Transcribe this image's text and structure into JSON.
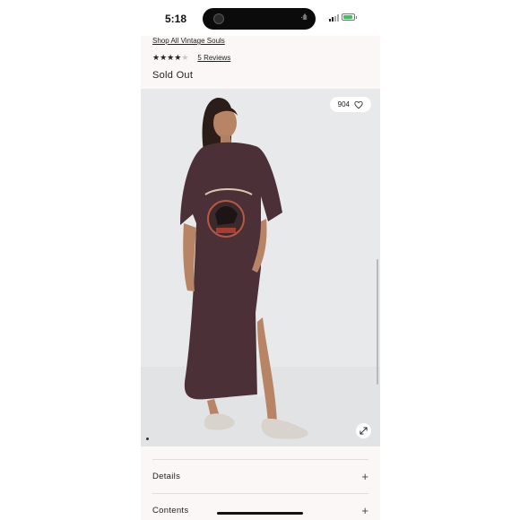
{
  "status_bar": {
    "time": "5:18"
  },
  "product": {
    "shop_link": "Shop All Vintage Souls",
    "rating_stars": 4,
    "rating_max": 5,
    "reviews_label": "5 Reviews",
    "availability": "Sold Out"
  },
  "gallery": {
    "likes_count": "904",
    "image_alt": "Model wearing brown oversized graphic tee maxi dress"
  },
  "accordion": [
    {
      "label": "Details"
    },
    {
      "label": "Contents"
    }
  ],
  "colors": {
    "page_bg": "#fbf7f6",
    "dress": "#4b3038",
    "image_bg": "#e8e9eb",
    "battery": "#34c759"
  },
  "icons": [
    "heart-icon",
    "expand-icon",
    "plus-icon",
    "star-icon"
  ]
}
